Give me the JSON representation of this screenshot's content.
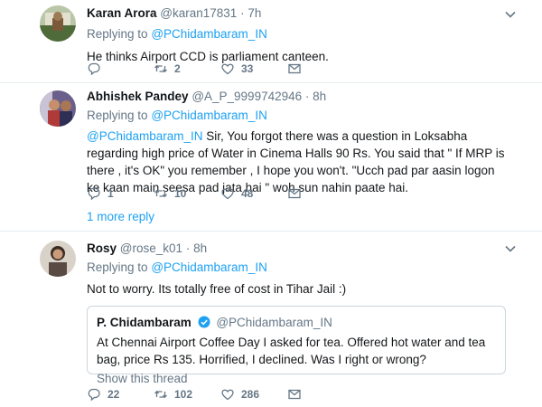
{
  "tweets": [
    {
      "name": "Karan Arora",
      "handle": "@karan17831",
      "dot": "·",
      "time": "7h",
      "replying_label": "Replying to",
      "replying_to": "@PChidambaram_IN",
      "text": "He thinks Airport CCD is parliament canteen.",
      "replies": "",
      "retweets": "2",
      "likes": "33"
    },
    {
      "name": "Abhishek Pandey",
      "handle": "@A_P_9999742946",
      "dot": "·",
      "time": "8h",
      "replying_label": "Replying to",
      "replying_to": "@PChidambaram_IN",
      "mention": "@PChidambaram_IN",
      "text": " Sir, You forgot there was a question in Loksabha regarding high price of Water in Cinema Halls 90 Rs. You said that \" If MRP is there , it's OK\" you remember , I hope you won't. \"Ucch pad par aasin logon ke kaan main seesa pad jata hai \" woh sun  nahin paate hai.",
      "replies": "1",
      "retweets": "10",
      "likes": "48",
      "more_replies": "1 more reply"
    },
    {
      "name": "Rosy",
      "handle": "@rose_k01",
      "dot": "·",
      "time": "8h",
      "replying_label": "Replying to",
      "replying_to": "@PChidambaram_IN",
      "text": "Not to worry. Its totally free of cost in Tihar Jail :)",
      "replies": "22",
      "retweets": "102",
      "likes": "286",
      "quote": {
        "name": "P. Chidambaram",
        "handle": "@PChidambaram_IN",
        "text": "At Chennai Airport Coffee Day I asked for tea. Offered hot water and tea bag, price Rs  135. Horrified, I declined. Was I right or wrong?",
        "show_thread": "Show this thread"
      }
    }
  ],
  "colors": {
    "link": "#1da1f2",
    "secondary": "#657786",
    "border": "#e6ecf0"
  },
  "icons": [
    "reply-icon",
    "retweet-icon",
    "like-icon",
    "dm-icon",
    "chevron-down-icon",
    "verified-icon"
  ]
}
